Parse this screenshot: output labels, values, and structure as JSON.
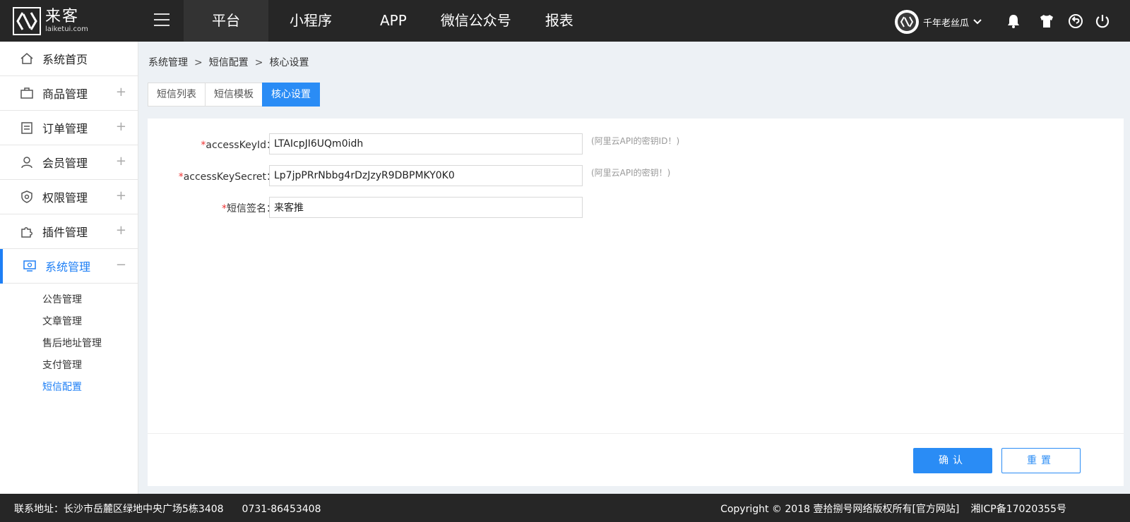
{
  "logo": {
    "cn": "来客",
    "en": "laiketui.com"
  },
  "nav": [
    {
      "label": "平台"
    },
    {
      "label": "小程序"
    },
    {
      "label": "APP"
    },
    {
      "label": "微信公众号"
    },
    {
      "label": "报表"
    }
  ],
  "user": {
    "name": "千年老丝瓜"
  },
  "top_icons": [
    "bell-icon",
    "shirt-icon",
    "back-icon",
    "power-icon"
  ],
  "sidebar": {
    "items": [
      {
        "label": "系统首页",
        "icon": "home-icon"
      },
      {
        "label": "商品管理",
        "icon": "bag-icon",
        "expand": "+"
      },
      {
        "label": "订单管理",
        "icon": "clipboard-icon",
        "expand": "+"
      },
      {
        "label": "会员管理",
        "icon": "user-icon",
        "expand": "+"
      },
      {
        "label": "权限管理",
        "icon": "shield-icon",
        "expand": "+"
      },
      {
        "label": "插件管理",
        "icon": "puzzle-icon",
        "expand": "+"
      },
      {
        "label": "系统管理",
        "icon": "monitor-icon",
        "expand": "−"
      }
    ],
    "subitems": [
      {
        "label": "公告管理"
      },
      {
        "label": "文章管理"
      },
      {
        "label": "售后地址管理"
      },
      {
        "label": "支付管理"
      },
      {
        "label": "短信配置"
      }
    ]
  },
  "breadcrumb": [
    "系统管理",
    "短信配置",
    "核心设置"
  ],
  "breadcrumb_sep": ">",
  "tabs": [
    {
      "label": "短信列表"
    },
    {
      "label": "短信模板"
    },
    {
      "label": "核心设置"
    }
  ],
  "form": {
    "required_mark": "*",
    "fields": [
      {
        "label": "accessKeyId：",
        "value": "LTAIcpJI6UQm0idh",
        "hint": "(阿里云API的密钥ID！)"
      },
      {
        "label": "accessKeySecret：",
        "value": "Lp7jpPRrNbbg4rDzJzyR9DBPMKY0K0",
        "hint": "(阿里云API的密钥！)"
      },
      {
        "label": "短信签名：",
        "value": "来客推",
        "hint": ""
      }
    ]
  },
  "buttons": {
    "confirm": "确认",
    "reset": "重置"
  },
  "footer": {
    "address": "联系地址：长沙市岳麓区绿地中央广场5栋3408",
    "phone": "0731-86453408",
    "copyright": "Copyright © 2018 壹拾捌号网络版权所有[官方网站]",
    "icp": "湘ICP备17020355号"
  },
  "colors": {
    "accent": "#2a8cf5",
    "topbar": "#262626",
    "required": "#e33333"
  }
}
